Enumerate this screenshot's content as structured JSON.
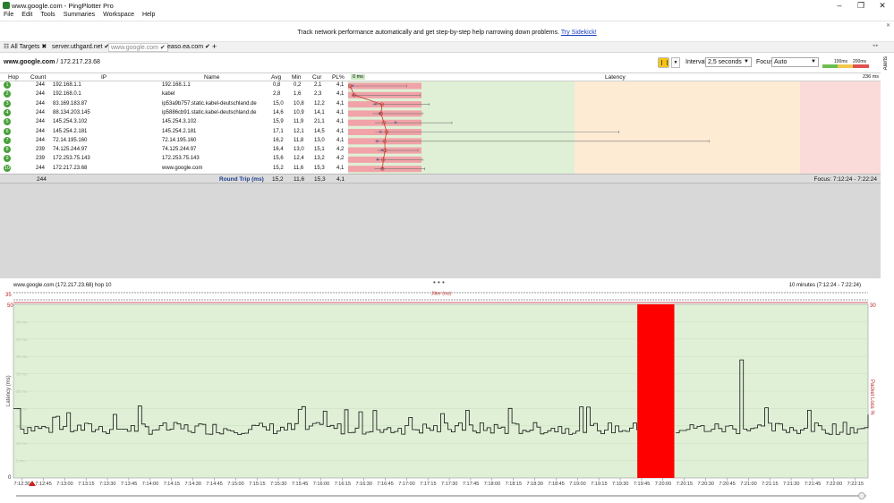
{
  "window": {
    "title": "www.google.com - PingPlotter Pro",
    "buttons": [
      "–",
      "❒",
      "✕"
    ]
  },
  "menu": [
    "File",
    "Edit",
    "Tools",
    "Summaries",
    "Workspace",
    "Help"
  ],
  "banner": {
    "text": "Track network performance automatically and get step-by-step help narrowing down problems.",
    "link": "Try Sidekick!"
  },
  "tabs": [
    {
      "label": "All Targets",
      "active": false
    },
    {
      "label": "server.uthgard.net",
      "active": false
    },
    {
      "label": "www.google.com",
      "active": true
    },
    {
      "label": "easo.ea.com",
      "active": false
    }
  ],
  "target": {
    "host": "www.google.com",
    "ip": "/ 172.217.23.68"
  },
  "controls": {
    "interval_label": "Interval",
    "interval_value": "2,5 seconds",
    "focus_label": "Focus",
    "focus_value": "Auto",
    "legend_100": "100ms",
    "legend_200": "200ms",
    "alerts": "Alerts"
  },
  "table": {
    "headers": {
      "hop": "Hop",
      "count": "Count",
      "ip": "IP",
      "name": "Name",
      "avg": "Avg",
      "min": "Min",
      "cur": "Cur",
      "pl": "PL%",
      "zero": "0 ms",
      "latency": "Latency",
      "max": "236 ms"
    },
    "rows": [
      {
        "hop": "1",
        "count": "244",
        "ip": "192.168.1.1",
        "name": "192.168.1.1",
        "avg": "0,8",
        "min": "0,2",
        "cur": "2,1",
        "pl": "4,1"
      },
      {
        "hop": "2",
        "count": "244",
        "ip": "192.168.0.1",
        "name": "kabel",
        "avg": "2,8",
        "min": "1,6",
        "cur": "2,3",
        "pl": "4,1"
      },
      {
        "hop": "3",
        "count": "244",
        "ip": "83.169.183.87",
        "name": "ip53a9b757.static.kabel-deutschland.de",
        "avg": "15,0",
        "min": "10,8",
        "cur": "12,2",
        "pl": "4,1"
      },
      {
        "hop": "4",
        "count": "244",
        "ip": "88.134.203.145",
        "name": "ip5886cb91.static.kabel-deutschland.de",
        "avg": "14,6",
        "min": "10,9",
        "cur": "14,1",
        "pl": "4,1"
      },
      {
        "hop": "5",
        "count": "244",
        "ip": "145.254.3.102",
        "name": "145.254.3.102",
        "avg": "15,9",
        "min": "11,9",
        "cur": "21,1",
        "pl": "4,1"
      },
      {
        "hop": "6",
        "count": "244",
        "ip": "145.254.2.181",
        "name": "145.254.2.181",
        "avg": "17,1",
        "min": "12,1",
        "cur": "14,5",
        "pl": "4,1"
      },
      {
        "hop": "7",
        "count": "244",
        "ip": "72.14.195.160",
        "name": "72.14.195.160",
        "avg": "16,2",
        "min": "11,8",
        "cur": "13,0",
        "pl": "4,1"
      },
      {
        "hop": "8",
        "count": "239",
        "ip": "74.125.244.97",
        "name": "74.125.244.97",
        "avg": "16,4",
        "min": "13,0",
        "cur": "15,1",
        "pl": "4,2"
      },
      {
        "hop": "9",
        "count": "239",
        "ip": "172.253.75.143",
        "name": "172.253.75.143",
        "avg": "15,6",
        "min": "12,4",
        "cur": "13,2",
        "pl": "4,2"
      },
      {
        "hop": "10",
        "count": "244",
        "ip": "172.217.23.68",
        "name": "www.google.com",
        "avg": "15,2",
        "min": "11,6",
        "cur": "15,3",
        "pl": "4,1"
      }
    ],
    "summary": {
      "count": "244",
      "label": "Round Trip (ms)",
      "avg": "15,2",
      "min": "11,6",
      "cur": "15,3",
      "pl": "4,1",
      "focus": "Focus: 7:12:24 - 7:22:24"
    }
  },
  "colors": {
    "good": "#dff0d6",
    "warn": "#fdebd3",
    "bad": "#fbdada",
    "loss": "#ff0000",
    "hop": "#47a03a"
  },
  "timegraph": {
    "title": "www.google.com (172.217.23.68) hop 10",
    "range": "10 minutes (7:12:24 - 7:22:24)",
    "jitter_label": "Jitter (ms)",
    "jitter_max": "35",
    "y_left_label": "Latency (ms)",
    "y_right_label": "Packet Loss %",
    "y_max_left": "50",
    "y_min_left": "0",
    "y_max_right": "30",
    "y_ticks": [
      "45 ms",
      "40 ms",
      "35 ms",
      "30 ms",
      "25 ms",
      "20 ms",
      "15 ms",
      "10 ms",
      "5 ms"
    ],
    "x_ticks": [
      "7:12:30",
      "7:12:45",
      "7:13:00",
      "7:13:15",
      "7:13:30",
      "7:13:45",
      "7:14:00",
      "7:14:15",
      "7:14:30",
      "7:14:45",
      "7:15:00",
      "7:15:15",
      "7:15:30",
      "7:15:45",
      "7:16:00",
      "7:16:15",
      "7:16:30",
      "7:16:45",
      "7:17:00",
      "7:17:15",
      "7:17:30",
      "7:17:45",
      "7:18:00",
      "7:18:15",
      "7:18:30",
      "7:18:45",
      "7:19:00",
      "7:19:15",
      "7:19:30",
      "7:19:45",
      "7:20:00",
      "7:20:15",
      "7:20:30",
      "7:20:45",
      "7:21:00",
      "7:21:15",
      "7:21:30",
      "7:21:45",
      "7:22:00",
      "7:22:15"
    ]
  },
  "chart_data": {
    "type": "line",
    "title": "www.google.com (172.217.23.68) hop 10",
    "xlabel": "",
    "ylabel": "Latency (ms)",
    "ylim": [
      0,
      50
    ],
    "x_range": [
      "7:12:24",
      "7:22:24"
    ],
    "loss_window": [
      "7:19:42",
      "7:20:08"
    ],
    "spike": {
      "x": "7:20:55",
      "y": 34
    }
  }
}
